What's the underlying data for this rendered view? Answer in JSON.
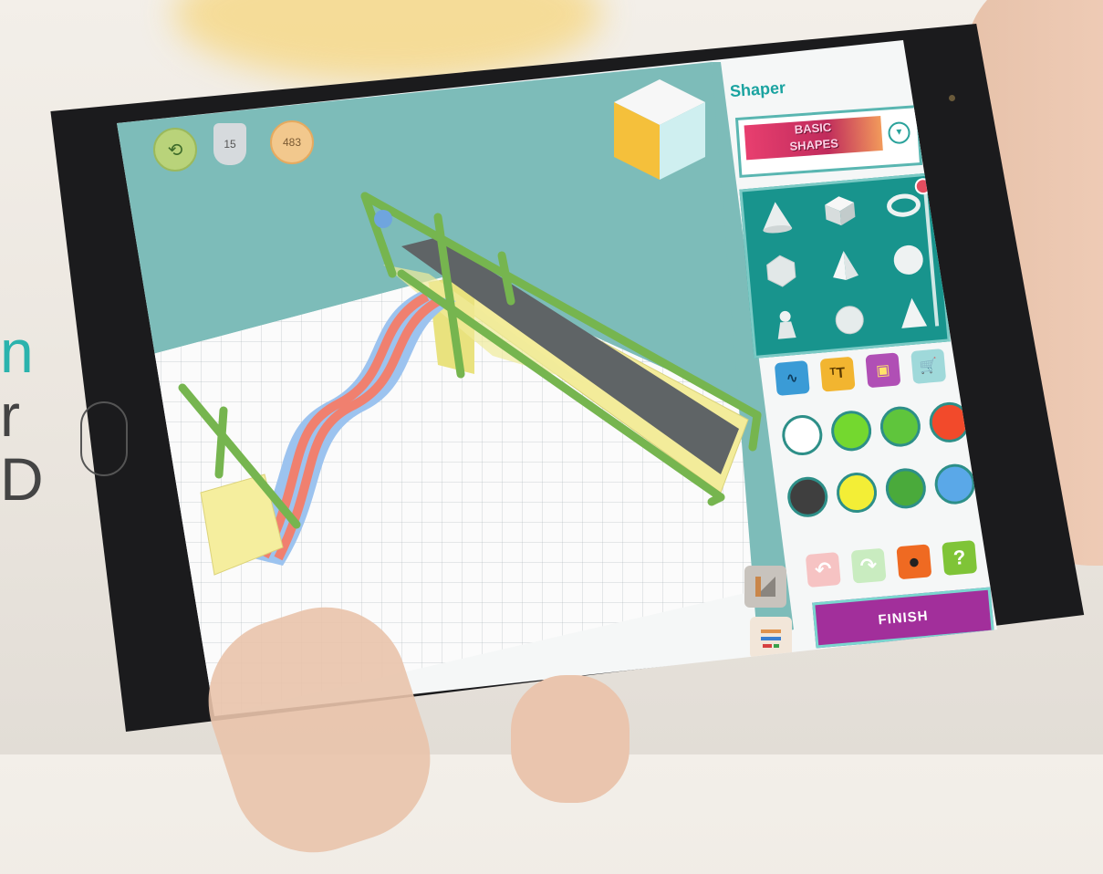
{
  "side_text": {
    "line1": "n",
    "line2": "r",
    "line3": "D"
  },
  "top_bar": {
    "undo_icon": "undo-arrow-icon",
    "badge_value": "15",
    "coins_value": "483"
  },
  "panel": {
    "title": "Shaper",
    "category": {
      "label_line1": "BASIC",
      "label_line2": "SHAPES"
    },
    "shapes": [
      "cone",
      "cube",
      "torus",
      "icosahedron",
      "pyramid",
      "sphere",
      "pawn",
      "geodesic",
      "cone-tall"
    ],
    "tools": [
      {
        "name": "curve-tool",
        "color": "#3a9bd6",
        "glyph": "∿"
      },
      {
        "name": "text-tool",
        "color": "#f2b530",
        "glyph": "ᵀT"
      },
      {
        "name": "gift-tool",
        "color": "#b04fb5",
        "glyph": "▣"
      },
      {
        "name": "cart-tool",
        "color": "#9fd9da",
        "glyph": "🛒"
      }
    ],
    "colors": [
      "#ffffff",
      "#74d82f",
      "#5fc53c",
      "#f24a2b",
      "#3f3f3f",
      "#f3ee36",
      "#4aaa3b",
      "#5aa8e8"
    ],
    "actions": [
      {
        "name": "undo",
        "color": "#f6c3c3",
        "glyph": "↶"
      },
      {
        "name": "redo",
        "color": "#c9ecc0",
        "glyph": "↷"
      },
      {
        "name": "bomb",
        "color": "#ef6a22",
        "glyph": "●"
      },
      {
        "name": "help",
        "color": "#7fc437",
        "glyph": "?"
      }
    ],
    "finish_label": "FINISH"
  }
}
